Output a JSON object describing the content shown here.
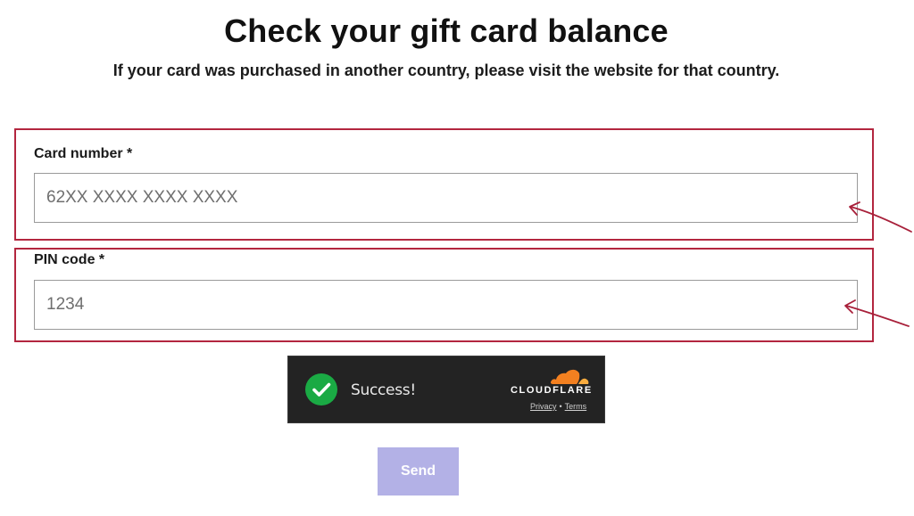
{
  "header": {
    "title": "Check your gift card balance",
    "subtitle": "If your card was purchased in another country, please visit the website for that country."
  },
  "form": {
    "card_number": {
      "label": "Card number *",
      "placeholder": "62XX XXXX XXXX XXXX",
      "value": ""
    },
    "pin_code": {
      "label": "PIN code *",
      "placeholder": "1234",
      "value": ""
    },
    "send_label": "Send"
  },
  "captcha": {
    "status": "Success!",
    "brand": "CLOUDFLARE",
    "privacy_label": "Privacy",
    "separator": "•",
    "terms_label": "Terms",
    "icons": [
      "check-icon",
      "cloudflare-cloud-icon"
    ]
  },
  "annotations": {
    "highlight_color": "#b3263f",
    "arrow_color": "#a8203a"
  },
  "colors": {
    "captcha_background": "#232323",
    "captcha_success": "#1aaa44",
    "cloudflare_orange": "#f38020",
    "send_button": "#b3b1e6"
  }
}
